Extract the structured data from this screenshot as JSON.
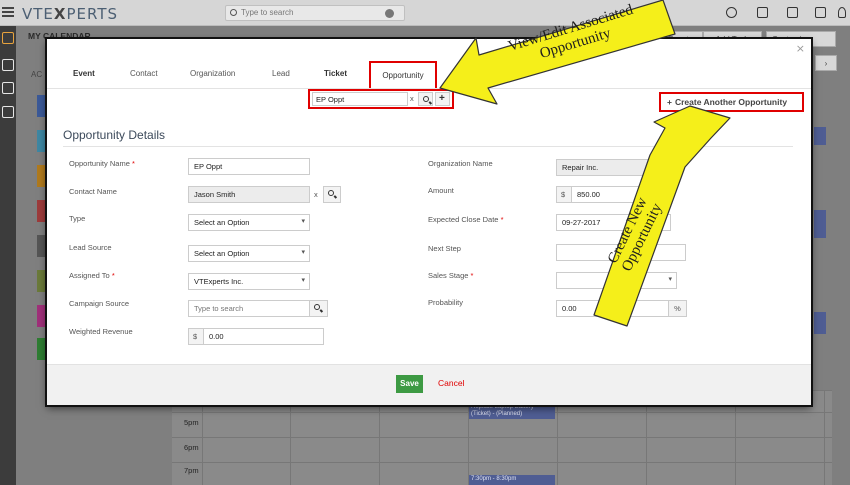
{
  "app": {
    "brand_a": "VTE",
    "brand_b": "X",
    "brand_c": "PERTS",
    "search_placeholder": "Type to search",
    "page_title": "MY CALENDAR",
    "ac_label": "AC"
  },
  "toolbar": {
    "add_event": "Event",
    "add_task": "+ Add Task",
    "customize": "Customize"
  },
  "calendar": {
    "hours": [
      "5pm",
      "6pm",
      "7pm"
    ],
    "event1": "Replace Laptop Battery (Ticket) - (Planned)",
    "event2": "7:30pm - 8:30pm"
  },
  "modal": {
    "tabs": [
      "Event",
      "Contact",
      "Organization",
      "Lead",
      "Ticket",
      "Opportunity"
    ],
    "link_value": "EP Oppt",
    "link_clear": "x",
    "create_label": "Create Another Opportunity",
    "section_title": "Opportunity Details",
    "left_fields": [
      {
        "label": "Opportunity Name",
        "required": true,
        "value": "EP Oppt"
      },
      {
        "label": "Contact Name",
        "required": false,
        "value": "Jason Smith"
      },
      {
        "label": "Type",
        "required": false,
        "value": "Select an Option"
      },
      {
        "label": "Lead Source",
        "required": false,
        "value": "Select an Option"
      },
      {
        "label": "Assigned To",
        "required": true,
        "value": "VTExperts Inc."
      },
      {
        "label": "Campaign Source",
        "required": false,
        "value": "Type to search"
      },
      {
        "label": "Weighted Revenue",
        "required": false,
        "value": "0.00"
      }
    ],
    "right_fields": [
      {
        "label": "Organization Name",
        "required": false,
        "value": "Repair Inc."
      },
      {
        "label": "Amount",
        "required": false,
        "value": "850.00"
      },
      {
        "label": "Expected Close Date",
        "required": true,
        "value": "09-27-2017"
      },
      {
        "label": "Next Step",
        "required": false,
        "value": ""
      },
      {
        "label": "Sales Stage",
        "required": true,
        "value": ""
      },
      {
        "label": "Probability",
        "required": false,
        "value": "0.00"
      }
    ],
    "currency_symbol": "$",
    "contact_clear": "x",
    "percent_symbol": "%",
    "save_label": "Save",
    "cancel_label": "Cancel",
    "close_glyph": "×"
  },
  "callouts": {
    "top": "View/Edit Associated Opportunity",
    "right": "Create New Opportunity"
  },
  "colors": {
    "required": "#e00000",
    "highlight": "#e00000",
    "save": "#3d9a43",
    "callout": "#f5ef1a"
  }
}
